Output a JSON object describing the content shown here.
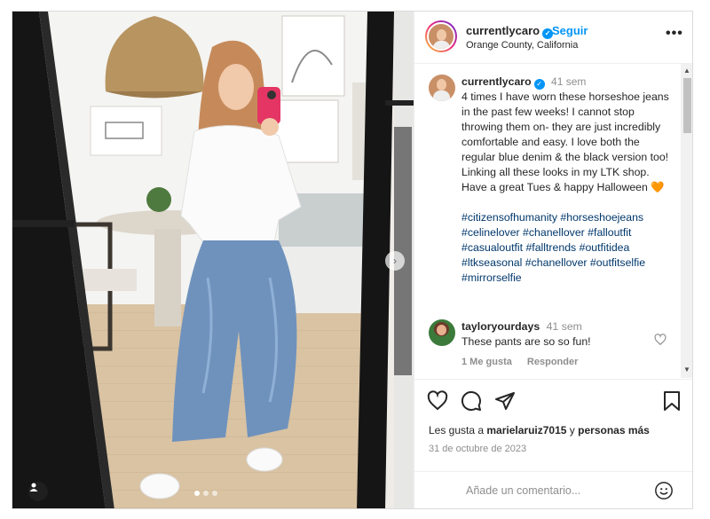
{
  "post": {
    "username": "currentlycaro",
    "follow_label": "Seguir",
    "location": "Orange County, California",
    "more_label": "•••"
  },
  "caption": {
    "username": "currentlycaro",
    "time": "41 sem",
    "text": "4 times I have worn these horseshoe jeans in the past few weeks! I cannot stop throwing them on- they are just incredibly comfortable and easy. I love both the regular blue denim & the black version too! Linking all these looks in my LTK shop. Have a great Tues & happy Halloween 🧡",
    "hashtags": "#citizensofhumanity #horseshoejeans #celinelover #chanellover #falloutfit #casualoutfit #falltrends #outfitidea #ltkseasonal #chanellover #outfitselfie #mirrorselfie"
  },
  "comment": {
    "username": "tayloryourdays",
    "time": "41 sem",
    "text": "These pants are so so fun!",
    "likes_label": "1 Me gusta",
    "reply_label": "Responder"
  },
  "footer": {
    "likes_prefix": "Les gusta a",
    "likes_user": "marielaruiz7015",
    "likes_middle": "y",
    "likes_suffix": "personas más",
    "date": "31 de octubre de 2023",
    "add_comment_placeholder": "Añade un comentario..."
  },
  "colors": {
    "accent": "#0095f6",
    "hashtag": "#00376b",
    "muted": "#8e8e8e"
  },
  "carousel": {
    "slides": 3,
    "active_index": 0
  }
}
